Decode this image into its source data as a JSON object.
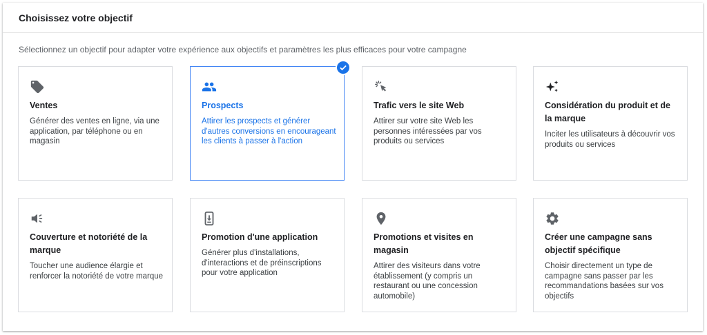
{
  "header": {
    "title": "Choisissez votre objectif"
  },
  "subtitle": "Sélectionnez un objectif pour adapter votre expérience aux objectifs et paramètres les plus efficaces pour votre campagne",
  "colors": {
    "accent": "#1a73e8",
    "icon": "#5f6368",
    "border": "#dadce0"
  },
  "cards": [
    {
      "icon": "tag-icon",
      "title": "Ventes",
      "desc": "Générer des ventes en ligne, via une application, par téléphone ou en magasin",
      "selected": false
    },
    {
      "icon": "people-icon",
      "title": "Prospects",
      "desc": "Attirer les prospects et générer d'autres conversions en encourageant les clients à passer à l'action",
      "selected": true
    },
    {
      "icon": "cursor-click-icon",
      "title": "Trafic vers le site Web",
      "desc": "Attirer sur votre site Web les personnes intéressées par vos produits ou services",
      "selected": false
    },
    {
      "icon": "sparkle-icon",
      "title": "Considération du produit et de la marque",
      "desc": "Inciter les utilisateurs à découvrir vos produits ou services",
      "selected": false
    },
    {
      "icon": "megaphone-icon",
      "title": "Couverture et notoriété de la marque",
      "desc": "Toucher une audience élargie et renforcer la notoriété de votre marque",
      "selected": false
    },
    {
      "icon": "phone-download-icon",
      "title": "Promotion d'une application",
      "desc": "Générer plus d'installations, d'interactions et de préinscriptions pour votre application",
      "selected": false
    },
    {
      "icon": "location-pin-icon",
      "title": "Promotions et visites en magasin",
      "desc": "Attirer des visiteurs dans votre établissement (y compris un restaurant ou une concession automobile)",
      "selected": false
    },
    {
      "icon": "gear-icon",
      "title": "Créer une campagne sans objectif spécifique",
      "desc": "Choisir directement un type de campagne sans passer par les recommandations basées sur vos objectifs",
      "selected": false
    }
  ]
}
